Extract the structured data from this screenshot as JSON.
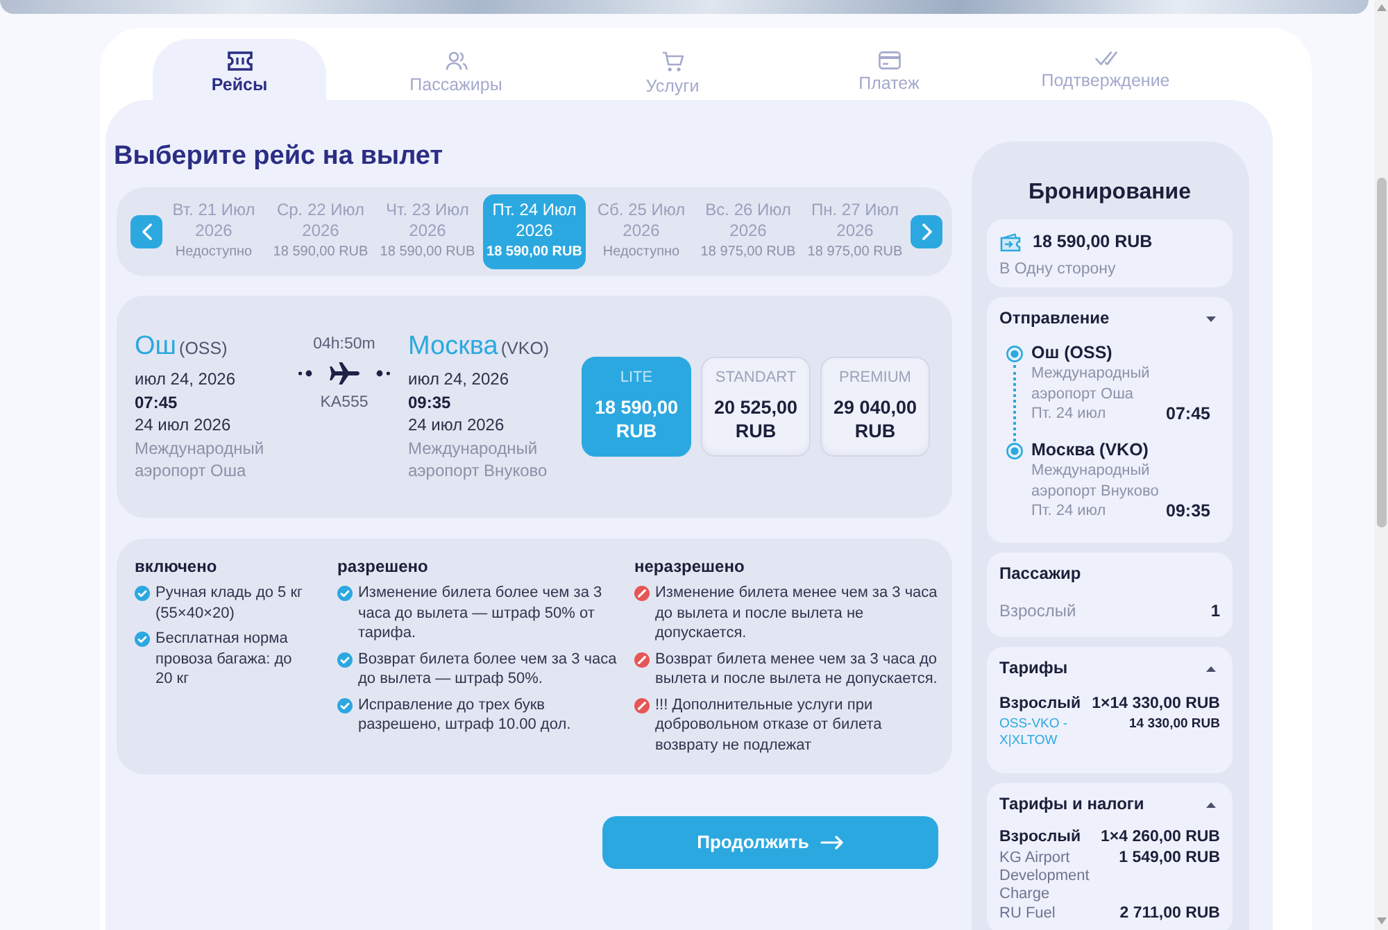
{
  "tabs": [
    {
      "label": "Рейсы",
      "selected": true
    },
    {
      "label": "Пассажиры",
      "selected": false
    },
    {
      "label": "Услуги",
      "selected": false
    },
    {
      "label": "Платеж",
      "selected": false
    },
    {
      "label": "Подтверждение",
      "selected": false
    }
  ],
  "heading": "Выберите рейс на вылет",
  "dates": [
    {
      "day": "Вт. 21 Июл",
      "year": "2026",
      "price": "Недоступно",
      "selected": false
    },
    {
      "day": "Ср. 22 Июл",
      "year": "2026",
      "price": "18 590,00 RUB",
      "selected": false
    },
    {
      "day": "Чт. 23 Июл",
      "year": "2026",
      "price": "18 590,00 RUB",
      "selected": false
    },
    {
      "day": "Пт. 24 Июл",
      "year": "2026",
      "price": "18 590,00 RUB",
      "selected": true
    },
    {
      "day": "Сб. 25 Июл",
      "year": "2026",
      "price": "Недоступно",
      "selected": false
    },
    {
      "day": "Вс. 26 Июл",
      "year": "2026",
      "price": "18 975,00 RUB",
      "selected": false
    },
    {
      "day": "Пн. 27 Июл",
      "year": "2026",
      "price": "18 975,00 RUB",
      "selected": false
    }
  ],
  "flight": {
    "departure": {
      "city": "Ош",
      "code": "(OSS)",
      "date": "июл 24, 2026",
      "time": "07:45",
      "date_long": "24 июл 2026",
      "airport": "Международный аэропорт Оша"
    },
    "duration": "04h:50m",
    "number": "KA555",
    "arrival": {
      "city": "Москва",
      "code": "(VKO)",
      "date": "июл 24, 2026",
      "time": "09:35",
      "date_long": "24 июл 2026",
      "airport": "Международный аэропорт Внуково"
    }
  },
  "fares": [
    {
      "name": "LITE",
      "amount": "18 590,00",
      "currency": "RUB",
      "selected": true
    },
    {
      "name": "STANDART",
      "amount": "20 525,00",
      "currency": "RUB",
      "selected": false
    },
    {
      "name": "PREMIUM",
      "amount": "29 040,00",
      "currency": "RUB",
      "selected": false
    }
  ],
  "rules": [
    {
      "title": "включено",
      "kind": "allowed",
      "items": [
        "Ручная кладь до 5 кг (55×40×20)",
        "Бесплатная норма провоза багажа: до 20 кг"
      ]
    },
    {
      "title": "разрешено",
      "kind": "allowed",
      "items": [
        "Изменение билета более чем за 3 часа до вылета — штраф 50% от тарифа.",
        "Возврат билета более чем за 3 часа до вылета — штраф 50%.",
        "Исправление до трех букв разрешено, штраф 10.00 дол."
      ]
    },
    {
      "title": "неразрешено",
      "kind": "forbidden",
      "items": [
        "Изменение билета менее чем за 3 часа до вылета и после вылета не допускается.",
        "Возврат билета менее чем за 3 часа до вылета и после вылета не допускается.",
        "!!! Дополнительные услуги при добровольном отказе от билета возврату не подлежат"
      ]
    }
  ],
  "continue_button": "Продолжить",
  "booking": {
    "title": "Бронирование",
    "total": "18 590,00 RUB",
    "trip_type": "В Одну сторону",
    "departure": {
      "title": "Отправление",
      "kind": "dropdown",
      "stops": [
        {
          "place": "Ош (OSS)",
          "airport": "Международный аэропорт Оша",
          "date": "Пт. 24 июл",
          "time": "07:45"
        },
        {
          "place": "Москва (VKO)",
          "airport": "Международный аэропорт Внуково",
          "date": "Пт. 24 июл",
          "time": "09:35"
        }
      ]
    },
    "passengers": {
      "title": "Пассажир",
      "rows": [
        {
          "label": "Взрослый",
          "count": "1"
        }
      ]
    },
    "price_sections": [
      {
        "title": "Тарифы",
        "kind": "accordion",
        "total_label": "Взрослый",
        "total": "1×14 330,00 RUB",
        "lines": [
          {
            "kind": "code",
            "label": "OSS-VKO - X|XLTOW",
            "amount": "14 330,00 RUB"
          }
        ]
      },
      {
        "title": "Тарифы и налоги",
        "kind": "accordion",
        "total_label": "Взрослый",
        "total": "1×4 260,00 RUB",
        "lines": [
          {
            "kind": "tax",
            "label": "KG Airport Development Charge",
            "amount": "1 549,00 RUB"
          },
          {
            "kind": "tax",
            "label": "RU Fuel",
            "amount": "2 711,00 RUB"
          }
        ]
      }
    ]
  }
}
